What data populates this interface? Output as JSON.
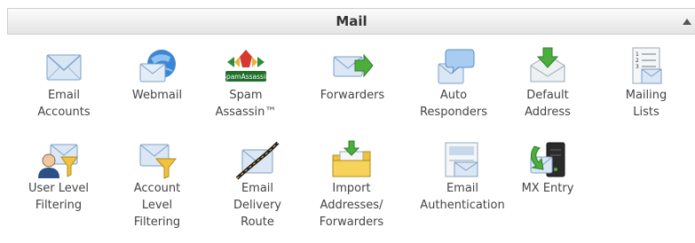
{
  "panel": {
    "title": "Mail",
    "spam_logo_text": "SpamAssassin"
  },
  "items": [
    {
      "label": "Email\nAccounts",
      "icon": "envelope-icon"
    },
    {
      "label": "Webmail",
      "icon": "globe-envelope-icon"
    },
    {
      "label": "Spam\nAssassin™",
      "icon": "spamassassin-icon"
    },
    {
      "label": "Forwarders",
      "icon": "forward-envelope-icon"
    },
    {
      "label": "Auto\nResponders",
      "icon": "auto-responder-icon"
    },
    {
      "label": "Default\nAddress",
      "icon": "default-address-icon"
    },
    {
      "label": "Mailing\nLists",
      "icon": "mailing-list-icon"
    },
    {
      "label": "User Level\nFiltering",
      "icon": "user-filter-icon"
    },
    {
      "label": "Account\nLevel\nFiltering",
      "icon": "account-filter-icon"
    },
    {
      "label": "Email\nDelivery\nRoute",
      "icon": "delivery-route-icon"
    },
    {
      "label": "Import\nAddresses/\nForwarders",
      "icon": "import-folder-icon"
    },
    {
      "label": "Email\nAuthentication",
      "icon": "authentication-icon"
    },
    {
      "label": "MX Entry",
      "icon": "mx-server-icon"
    }
  ]
}
